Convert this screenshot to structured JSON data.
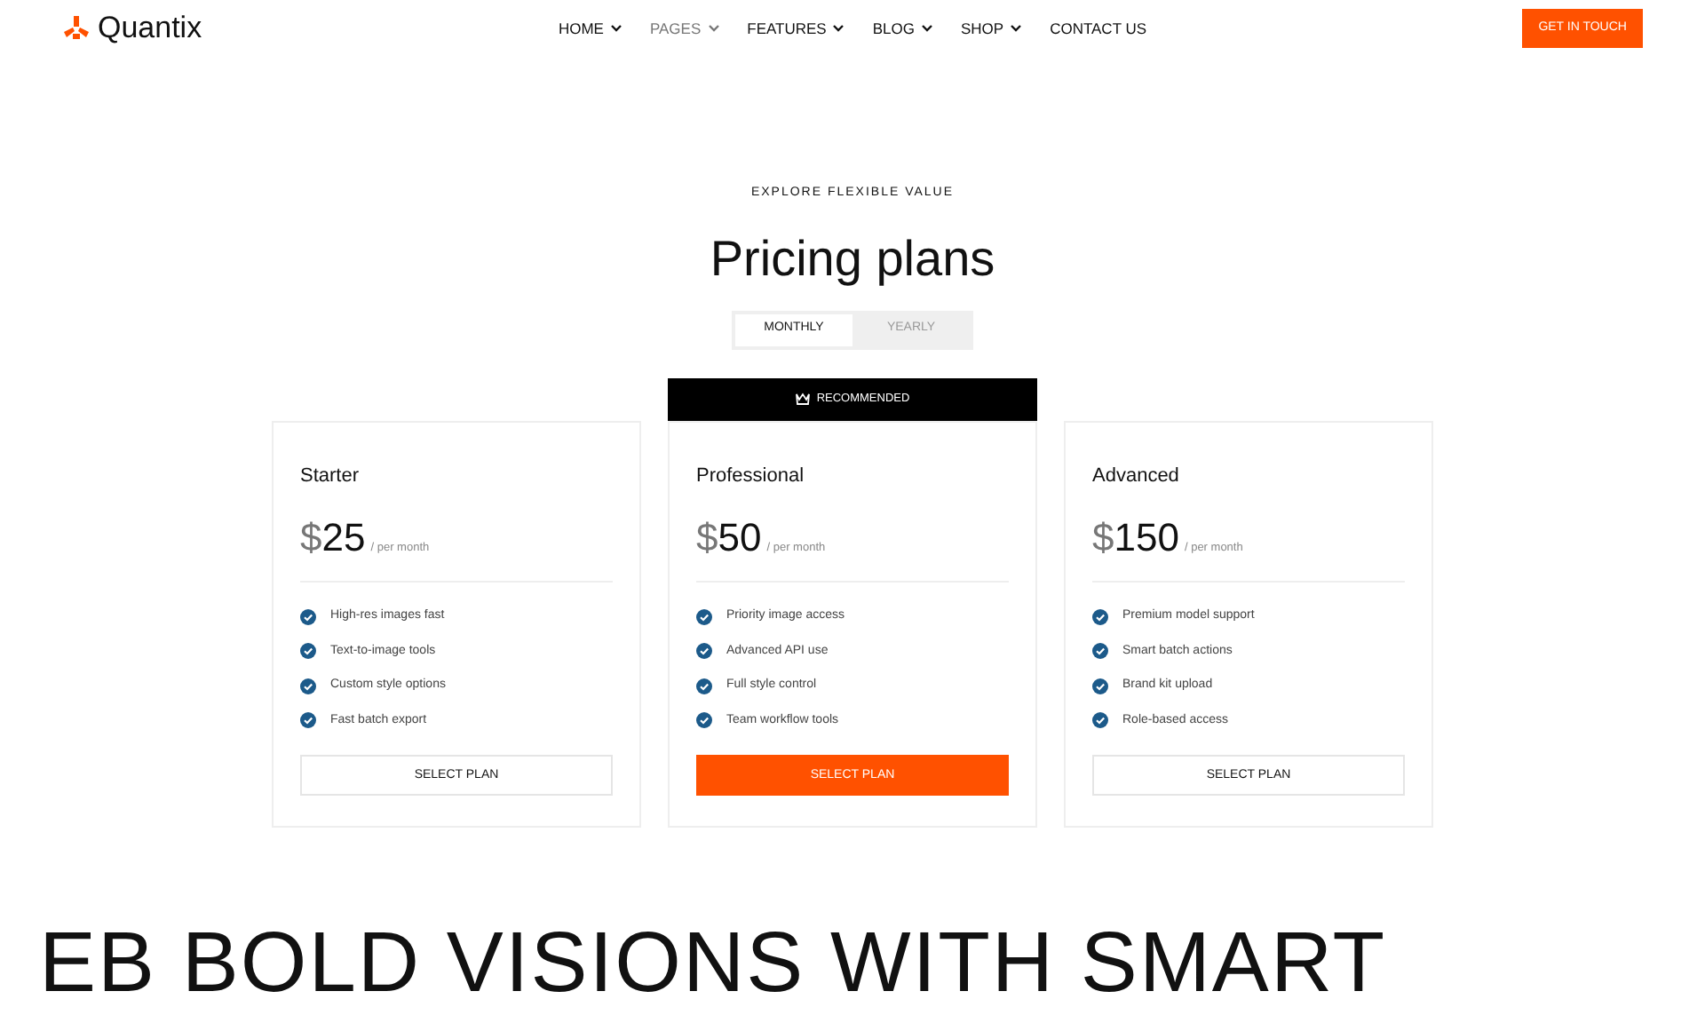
{
  "brand": {
    "name": "Quantix"
  },
  "nav": [
    {
      "label": "HOME",
      "selected": false,
      "dropdown": true
    },
    {
      "label": "PAGES",
      "selected": true,
      "dropdown": true
    },
    {
      "label": "FEATURES",
      "selected": false,
      "dropdown": true
    },
    {
      "label": "BLOG",
      "selected": false,
      "dropdown": true
    },
    {
      "label": "SHOP",
      "selected": false,
      "dropdown": true
    },
    {
      "label": "CONTACT US",
      "selected": false,
      "dropdown": false
    }
  ],
  "cta": "GET IN TOUCH",
  "eyebrow": "EXPLORE FLEXIBLE VALUE",
  "heading": "Pricing plans",
  "billing": [
    {
      "label": "MONTHLY",
      "selected": true
    },
    {
      "label": "YEARLY",
      "selected": false
    }
  ],
  "plans": [
    {
      "name": "Starter",
      "currency": "$",
      "price": "25",
      "period": "/ per month",
      "featured": false,
      "features": [
        "High-res images fast",
        "Text-to-image tools",
        "Custom style options",
        "Fast batch export"
      ],
      "button": "SELECT PLAN"
    },
    {
      "name": "Professional",
      "currency": "$",
      "price": "50",
      "period": "/ per month",
      "featured": true,
      "flag": "RECOMMENDED",
      "features": [
        "Priority image access",
        "Advanced API use",
        "Full style control",
        "Team workflow tools"
      ],
      "button": "SELECT PLAN"
    },
    {
      "name": "Advanced",
      "currency": "$",
      "price": "150",
      "period": "/ per month",
      "featured": false,
      "features": [
        "Premium model support",
        "Smart batch actions",
        "Brand kit upload",
        "Role-based access"
      ],
      "button": "SELECT PLAN"
    }
  ],
  "marquee": "EB BOLD VISIONS WITH SMART"
}
